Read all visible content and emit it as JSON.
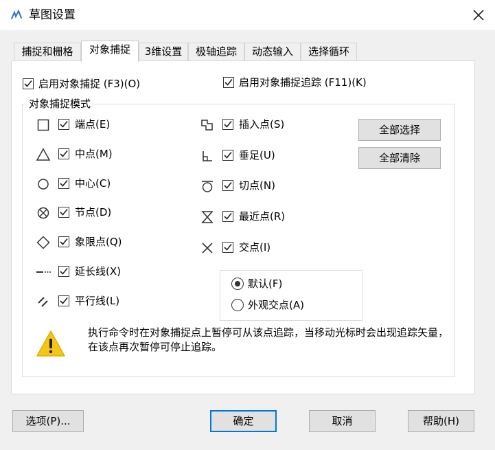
{
  "window": {
    "title": "草图设置",
    "icon": "sketch-settings-icon"
  },
  "tabs": [
    {
      "label": "捕捉和栅格",
      "active": false
    },
    {
      "label": "对象捕捉",
      "active": true
    },
    {
      "label": "3维设置",
      "active": false
    },
    {
      "label": "极轴追踪",
      "active": false
    },
    {
      "label": "动态输入",
      "active": false
    },
    {
      "label": "选择循环",
      "active": false
    }
  ],
  "top_options": {
    "enable_snap": {
      "label": "启用对象捕捉 (F3)(O)",
      "checked": true
    },
    "enable_tracking": {
      "label": "启用对象捕捉追踪 (F11)(K)",
      "checked": true
    }
  },
  "modes": {
    "title": "对象捕捉模式",
    "left": [
      {
        "icon": "square-icon",
        "label": "端点(E)",
        "checked": true
      },
      {
        "icon": "triangle-icon",
        "label": "中点(M)",
        "checked": true
      },
      {
        "icon": "circle-icon",
        "label": "中心(C)",
        "checked": true
      },
      {
        "icon": "node-icon",
        "label": "节点(D)",
        "checked": true
      },
      {
        "icon": "diamond-icon",
        "label": "象限点(Q)",
        "checked": true
      },
      {
        "icon": "extension-icon",
        "label": "延长线(X)",
        "checked": true
      },
      {
        "icon": "parallel-icon",
        "label": "平行线(L)",
        "checked": true
      }
    ],
    "right": [
      {
        "icon": "insert-icon",
        "label": "插入点(S)",
        "checked": true
      },
      {
        "icon": "perpendicular-icon",
        "label": "垂足(U)",
        "checked": true
      },
      {
        "icon": "tangent-icon",
        "label": "切点(N)",
        "checked": true
      },
      {
        "icon": "nearest-icon",
        "label": "最近点(R)",
        "checked": true
      },
      {
        "icon": "intersection-icon",
        "label": "交点(I)",
        "checked": true
      }
    ],
    "select_all": "全部选择",
    "clear_all": "全部清除",
    "radios": [
      {
        "label": "默认(F)",
        "selected": true
      },
      {
        "label": "外观交点(A)",
        "selected": false
      }
    ]
  },
  "note": {
    "icon": "warning-icon",
    "text": "执行命令时在对象捕捉点上暂停可从该点追踪，当移动光标时会出现追踪矢量，在该点再次暂停可停止追踪。"
  },
  "footer": {
    "options": "选项(P)...",
    "ok": "确定",
    "cancel": "取消",
    "help": "帮助(H)"
  },
  "colors": {
    "accent": "#0078d7",
    "warning": "#f5c518"
  }
}
